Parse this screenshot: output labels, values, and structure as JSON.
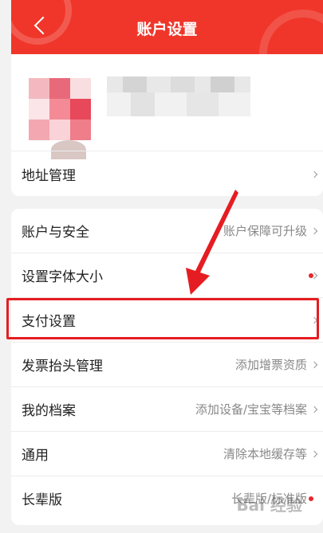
{
  "header": {
    "title": "账户设置",
    "color": "#f0362a"
  },
  "profile": {
    "address_label": "地址管理"
  },
  "settings": [
    {
      "label": "账户与安全",
      "value": "账户保障可升级"
    },
    {
      "label": "设置字体大小",
      "value": ""
    },
    {
      "label": "支付设置",
      "value": ""
    },
    {
      "label": "发票抬头管理",
      "value": "添加增票资质"
    },
    {
      "label": "我的档案",
      "value": "添加设备/宝宝等档案"
    },
    {
      "label": "通用",
      "value": "清除本地缓存等"
    },
    {
      "label": "长辈版",
      "value": "长辈版/标准版"
    }
  ],
  "watermark": "Bai 经验",
  "annotation_color": "#e51d22"
}
